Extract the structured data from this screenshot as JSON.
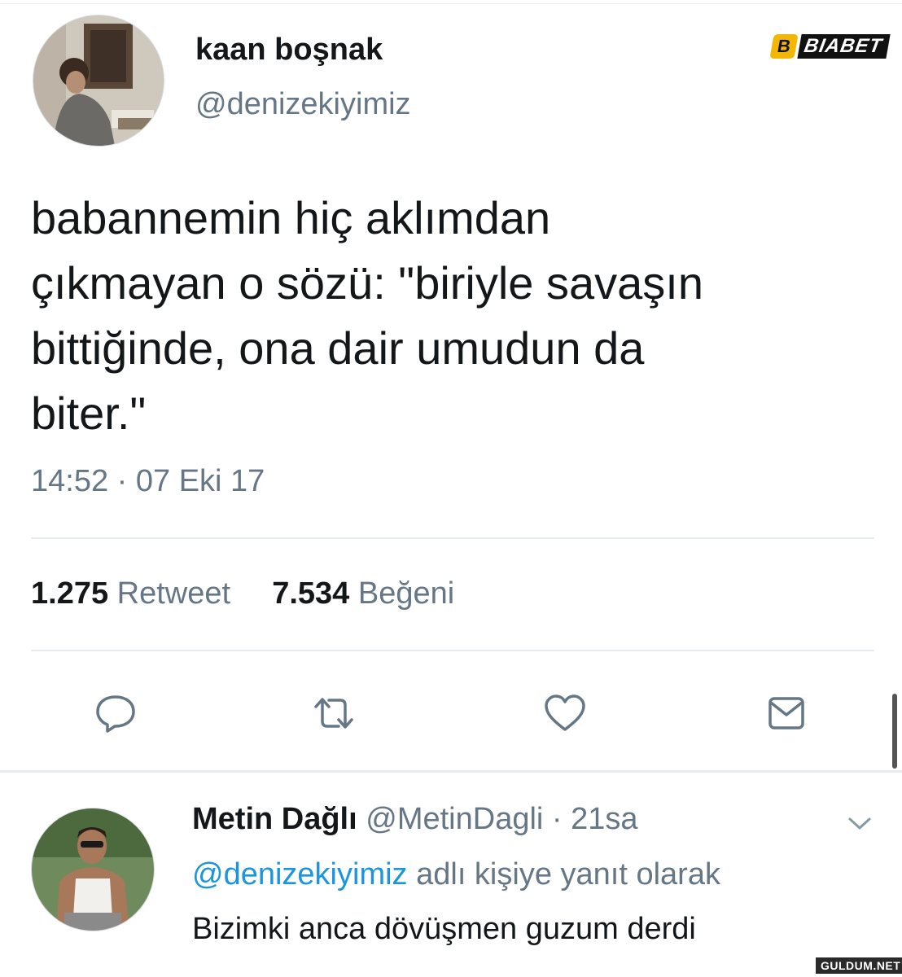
{
  "tweet": {
    "author_name": "kaan boşnak",
    "author_handle": "@denizekiyimiz",
    "text_lines": [
      "babannemin hiç aklımdan",
      "çıkmayan o sözü: \"biriyle savaşın",
      "bittiğinde, ona dair umudun da",
      "biter.\""
    ],
    "timestamp": "14:52 · 07 Eki 17",
    "retweet_count": "1.275",
    "retweet_label": "Retweet",
    "like_count": "7.534",
    "like_label": "Beğeni",
    "actions": [
      "reply-icon",
      "retweet-icon",
      "like-icon",
      "direct-message-icon"
    ]
  },
  "reply": {
    "author_name": "Metin Dağlı",
    "author_handle": "@MetinDagli",
    "separator": "·",
    "time_ago": "21sa",
    "in_reply_to_mention": "@denizekiyimiz",
    "in_reply_to_suffix": "adlı kişiye yanıt olarak",
    "text": "Bizimki anca dövüşmen guzum derdi"
  },
  "overlay": {
    "brand_logo": "BIABET",
    "brand_mark": "B",
    "watermark": "GULDUM.NET"
  },
  "colors": {
    "text": "#14171a",
    "secondary": "#657786",
    "link": "#1b95e0",
    "divider": "#e6ecf0"
  }
}
